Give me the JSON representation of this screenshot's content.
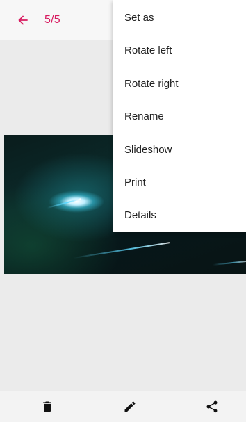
{
  "header": {
    "counter": "5/5",
    "back_icon": "arrow-left-icon",
    "accent_color": "#d81b60"
  },
  "menu": {
    "items": [
      {
        "label": "Set as"
      },
      {
        "label": "Rotate left"
      },
      {
        "label": "Rotate right"
      },
      {
        "label": "Rename"
      },
      {
        "label": "Slideshow"
      },
      {
        "label": "Print"
      },
      {
        "label": "Details"
      }
    ]
  },
  "bottom_bar": {
    "actions": [
      {
        "icon": "trash-icon"
      },
      {
        "icon": "pencil-icon"
      },
      {
        "icon": "share-icon"
      }
    ]
  }
}
